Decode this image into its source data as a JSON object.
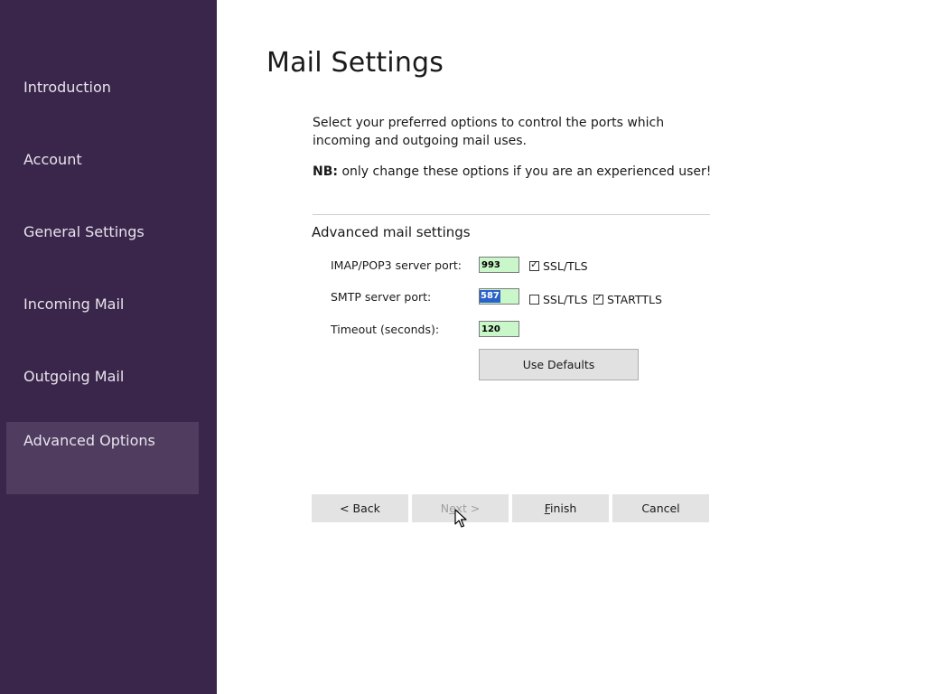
{
  "sidebar": {
    "items": [
      {
        "label": "Introduction"
      },
      {
        "label": "Account"
      },
      {
        "label": "General Settings"
      },
      {
        "label": "Incoming Mail"
      },
      {
        "label": "Outgoing Mail"
      },
      {
        "label": "Advanced Options",
        "active": true
      }
    ]
  },
  "page": {
    "title": "Mail Settings",
    "intro": "Select your preferred options to control the ports which incoming and outgoing mail uses.",
    "nb_label": "NB:",
    "nb_text": " only change these options if you are an experienced user!"
  },
  "advanced": {
    "section_title": "Advanced mail settings",
    "imap": {
      "label": "IMAP/POP3 server port:",
      "value": "993",
      "ssl_label": "SSL/TLS",
      "ssl_checked": true
    },
    "smtp": {
      "label": "SMTP server port:",
      "value": "587",
      "value_selected": true,
      "ssl_label": "SSL/TLS",
      "ssl_checked": false,
      "starttls_label": "STARTTLS",
      "starttls_checked": true
    },
    "timeout": {
      "label": "Timeout (seconds):",
      "value": "120"
    },
    "use_defaults_label": "Use Defaults"
  },
  "footer": {
    "back_label": "< Back",
    "next_prefix": "N",
    "next_mnemonic": "e",
    "next_suffix": "xt >",
    "next_disabled": true,
    "finish_mnemonic": "F",
    "finish_suffix": "inish",
    "cancel_label": "Cancel"
  },
  "colors": {
    "sidebar_bg": "#3a264a",
    "sidebar_active_bg": "#4f3c5f",
    "input_bg": "#c9f7c9",
    "selection": "#2a62c9"
  }
}
